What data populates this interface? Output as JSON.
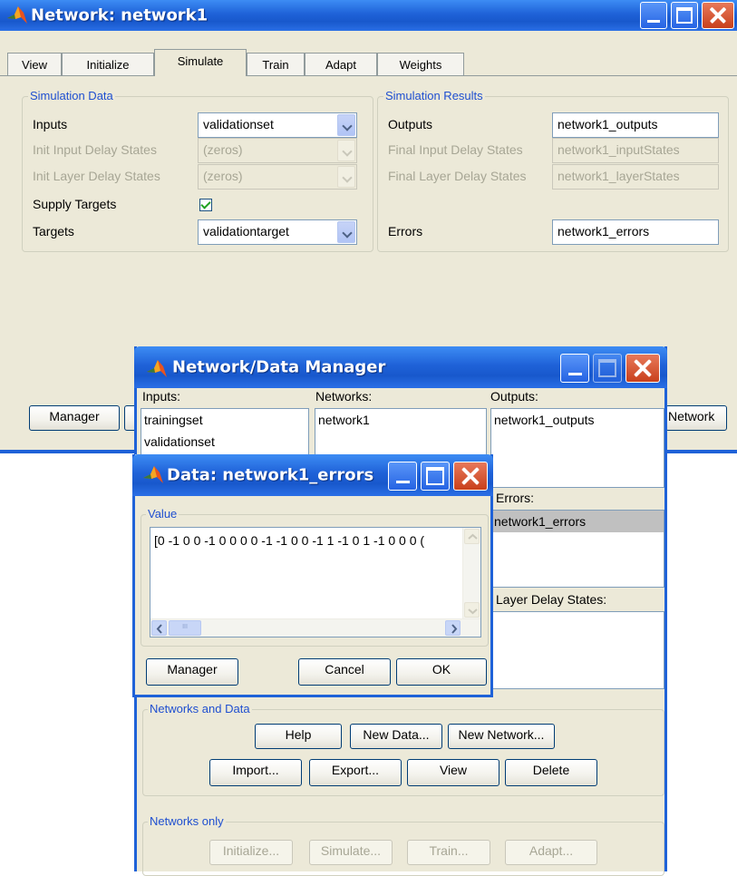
{
  "main_window": {
    "title": "Network: network1",
    "tabs": [
      {
        "label": "View"
      },
      {
        "label": "Initialize"
      },
      {
        "label": "Simulate"
      },
      {
        "label": "Train"
      },
      {
        "label": "Adapt"
      },
      {
        "label": "Weights"
      }
    ],
    "active_tab": "Simulate",
    "simulation_data": {
      "legend": "Simulation Data",
      "inputs_label": "Inputs",
      "inputs_value": "validationset",
      "init_input_label": "Init Input Delay States",
      "init_input_value": "(zeros)",
      "init_layer_label": "Init Layer Delay States",
      "init_layer_value": "(zeros)",
      "supply_targets_label": "Supply Targets",
      "supply_targets_checked": true,
      "targets_label": "Targets",
      "targets_value": "validationtarget"
    },
    "simulation_results": {
      "legend": "Simulation Results",
      "outputs_label": "Outputs",
      "outputs_value": "network1_outputs",
      "final_input_label": "Final Input Delay States",
      "final_input_value": "network1_inputStates",
      "final_layer_label": "Final Layer Delay States",
      "final_layer_value": "network1_layerStates",
      "errors_label": "Errors",
      "errors_value": "network1_errors"
    },
    "manager_button": "Manager",
    "network_button_partial": "Network"
  },
  "manager_window": {
    "title": "Network/Data Manager",
    "inputs_label": "Inputs:",
    "inputs_items": [
      "trainingset",
      "validationset"
    ],
    "networks_label": "Networks:",
    "networks_items": [
      "network1"
    ],
    "outputs_label": "Outputs:",
    "outputs_items": [
      "network1_outputs"
    ],
    "errors_label": "Errors:",
    "errors_items": [
      "network1_errors"
    ],
    "layer_delay_label": "Layer Delay States:",
    "networks_and_data": {
      "legend": "Networks and Data",
      "help": "Help",
      "new_data": "New Data...",
      "new_network": "New Network...",
      "import": "Import...",
      "export": "Export...",
      "view": "View",
      "delete": "Delete"
    },
    "networks_only": {
      "legend": "Networks only",
      "initialize": "Initialize...",
      "simulate": "Simulate...",
      "train": "Train...",
      "adapt": "Adapt..."
    }
  },
  "data_window": {
    "title": "Data: network1_errors",
    "value_legend": "Value",
    "value_text": "[0 -1 0 0 -1 0 0 0 0 -1 -1 0 0 -1 1 -1 0 1 -1 0 0 0 (",
    "scroll_grip": "III",
    "manager": "Manager",
    "cancel": "Cancel",
    "ok": "OK"
  },
  "colors": {
    "titlebar": "#1f62d8",
    "dialog_bg": "#ece9d8",
    "group_legend": "#1f4fd0",
    "close_button": "#c8401c"
  },
  "icons": [
    "matlab-logo-icon",
    "minimize-icon",
    "maximize-icon",
    "close-icon",
    "dropdown-arrow-icon",
    "checkmark-icon",
    "scroll-left-icon",
    "scroll-right-icon",
    "scroll-up-icon",
    "scroll-down-icon"
  ]
}
